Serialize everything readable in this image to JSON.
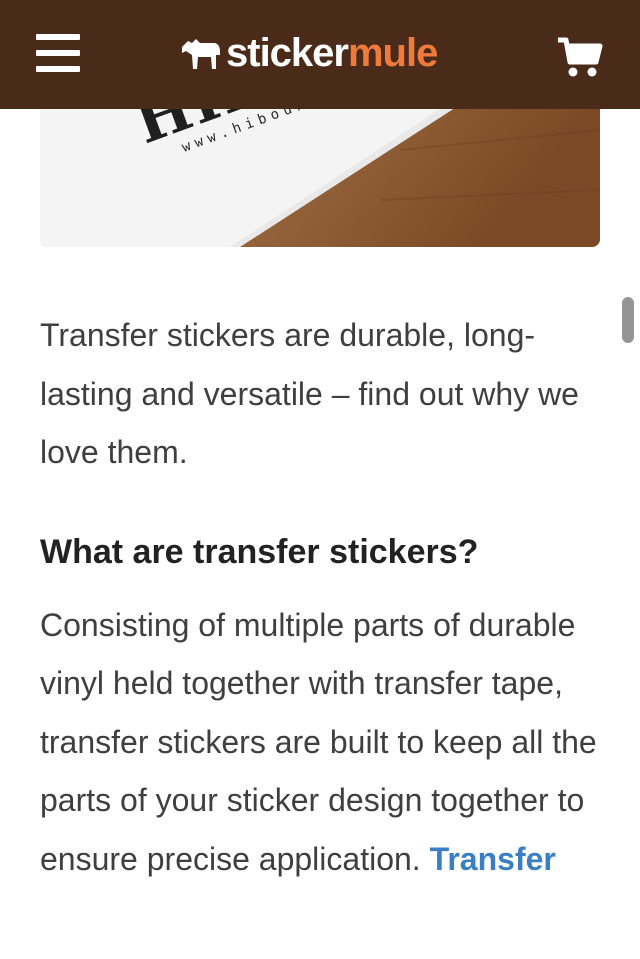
{
  "header": {
    "brand_part1": "sticker",
    "brand_part2": "mule",
    "menu_icon": "hamburger-menu-icon",
    "cart_icon": "shopping-cart-icon",
    "colors": {
      "bar": "#4a2a18",
      "accent": "#ee7a3b"
    }
  },
  "hero": {
    "sticker_word": "HIBOU",
    "sticker_url": "www.hiboux.co"
  },
  "article": {
    "intro": "Transfer stickers are durable, long-lasting and versatile – find out why we love them.",
    "heading": "What are transfer stickers?",
    "body": "Consisting of multiple parts of durable vinyl held together with transfer tape, transfer stickers are built to keep all the parts of your sticker design together to ensure precise application. ",
    "link_text": "Transfer",
    "link_color": "#3a7ec4"
  }
}
